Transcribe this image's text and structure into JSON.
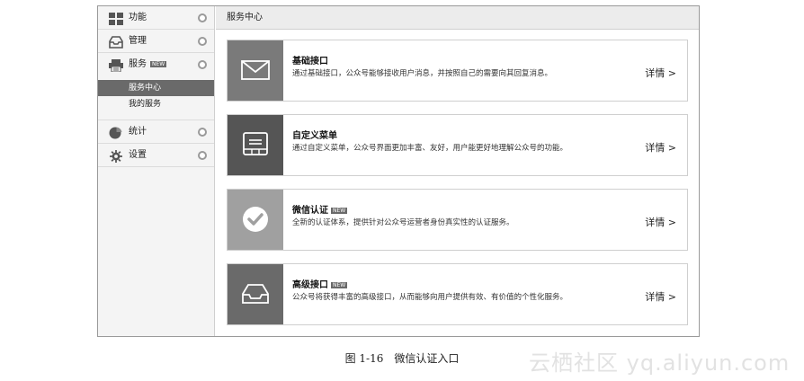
{
  "sidebar": {
    "items": [
      {
        "label": "功能",
        "icon": "grid-icon"
      },
      {
        "label": "管理",
        "icon": "inbox-icon"
      },
      {
        "label": "服务",
        "icon": "printer-icon",
        "badge": "NEW"
      },
      {
        "label": "统计",
        "icon": "pie-chart-icon"
      },
      {
        "label": "设置",
        "icon": "gear-icon"
      }
    ],
    "sub_items": [
      {
        "label": "服务中心",
        "active": true
      },
      {
        "label": "我的服务",
        "active": false
      }
    ]
  },
  "main": {
    "header_title": "服务中心",
    "cards": [
      {
        "title": "基础接口",
        "badge": "",
        "desc": "通过基础接口，公众号能够接收用户消息，并按照自己的需要向其回复消息。",
        "detail": "详情 >",
        "icon": "envelope-icon",
        "thumb_color": "#7a7a7a"
      },
      {
        "title": "自定义菜单",
        "badge": "",
        "desc": "通过自定义菜单，公众号界面更加丰富、友好，用户能更好地理解公众号的功能。",
        "detail": "详情 >",
        "icon": "screen-menu-icon",
        "thumb_color": "#555555"
      },
      {
        "title": "微信认证",
        "badge": "NEW",
        "desc": "全新的认证体系，提供针对公众号运营者身份真实性的认证服务。",
        "detail": "详情 >",
        "icon": "check-circle-icon",
        "thumb_color": "#a0a0a0"
      },
      {
        "title": "高级接口",
        "badge": "NEW",
        "desc": "公众号将获得丰富的高级接口，从而能够向用户提供有效、有价值的个性化服务。",
        "detail": "详情 >",
        "icon": "tray-icon",
        "thumb_color": "#6a6a6a"
      }
    ]
  },
  "caption": "图 1-16　微信认证入口",
  "watermark": "云栖社区 yq.aliyun.com"
}
